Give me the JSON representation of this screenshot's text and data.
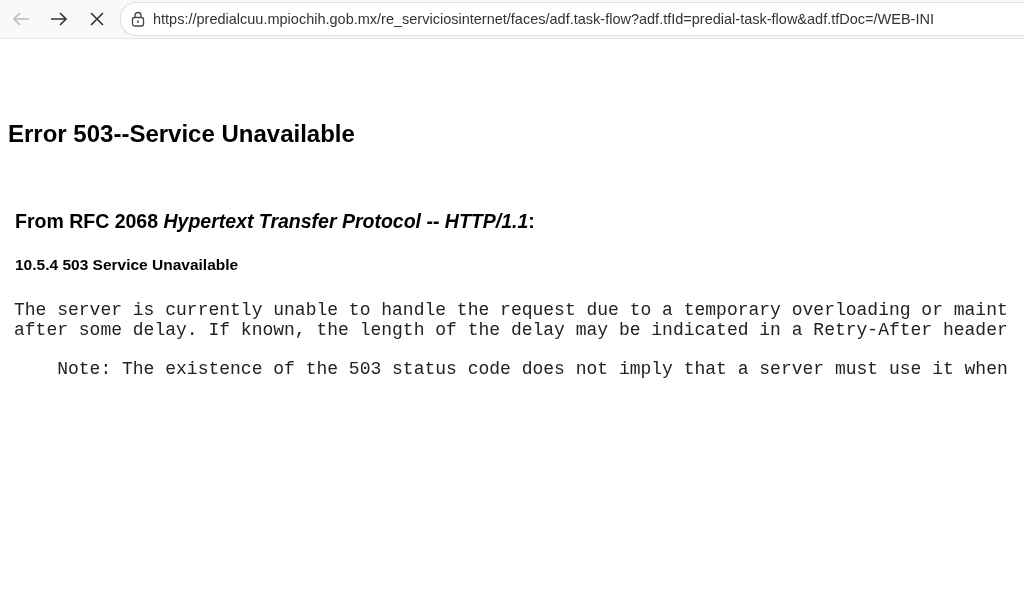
{
  "toolbar": {
    "back_disabled": true,
    "forward_disabled": false,
    "url": "https://predialcuu.mpiochih.gob.mx/re_serviciosinternet/faces/adf.task-flow?adf.tfId=predial-task-flow&adf.tfDoc=/WEB-INI"
  },
  "page": {
    "title": "Error 503--Service Unavailable",
    "source": "From RFC 2068 *Hypertext Transfer Protocol -- HTTP/1.1*:",
    "section": "10.5.4 503 Service Unavailable",
    "body_lines": [
      "The server is currently unable to handle the request due to a temporary overloading or maint",
      "after some delay. If known, the length of the delay may be indicated in a Retry-After header"
    ],
    "note": "    Note: The existence of the 503 status code does not imply that a server must use it when"
  }
}
